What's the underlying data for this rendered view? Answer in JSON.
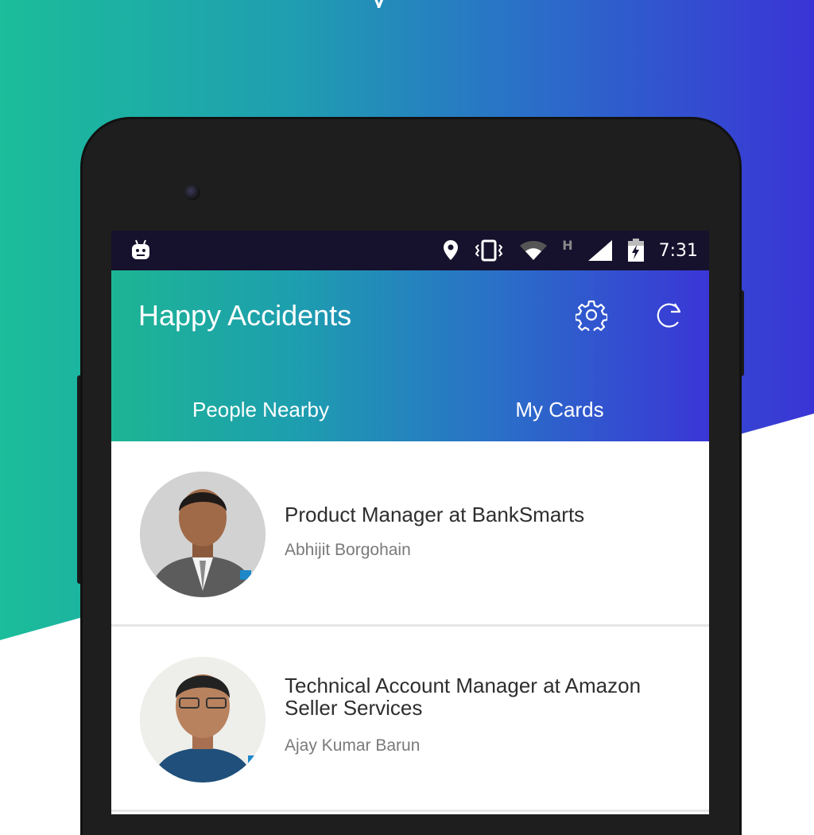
{
  "top_fragment": "y",
  "status_bar": {
    "time": "7:31",
    "network_indicator": "H",
    "icons": [
      "android-debug-icon",
      "location-icon",
      "vibrate-icon",
      "wifi-icon",
      "signal-icon",
      "battery-charging-icon"
    ]
  },
  "app": {
    "title": "Happy Accidents",
    "actions": [
      "gear-icon",
      "refresh-icon"
    ]
  },
  "tabs": [
    {
      "label": "People Nearby",
      "selected": true
    },
    {
      "label": "My Cards",
      "selected": false
    }
  ],
  "cards": [
    {
      "title": "Product Manager  at BankSmarts",
      "name": "Abhijit Borgohain"
    },
    {
      "title": "Technical Account Manager at Amazon Seller Services",
      "name": "Ajay Kumar Barun"
    }
  ],
  "colors": {
    "gradient_start": "#1bbd9a",
    "gradient_end": "#3a34d6",
    "status_bar": "#16112c",
    "title_text": "#2e2e2e",
    "subtitle_text": "#7a7a7a"
  }
}
